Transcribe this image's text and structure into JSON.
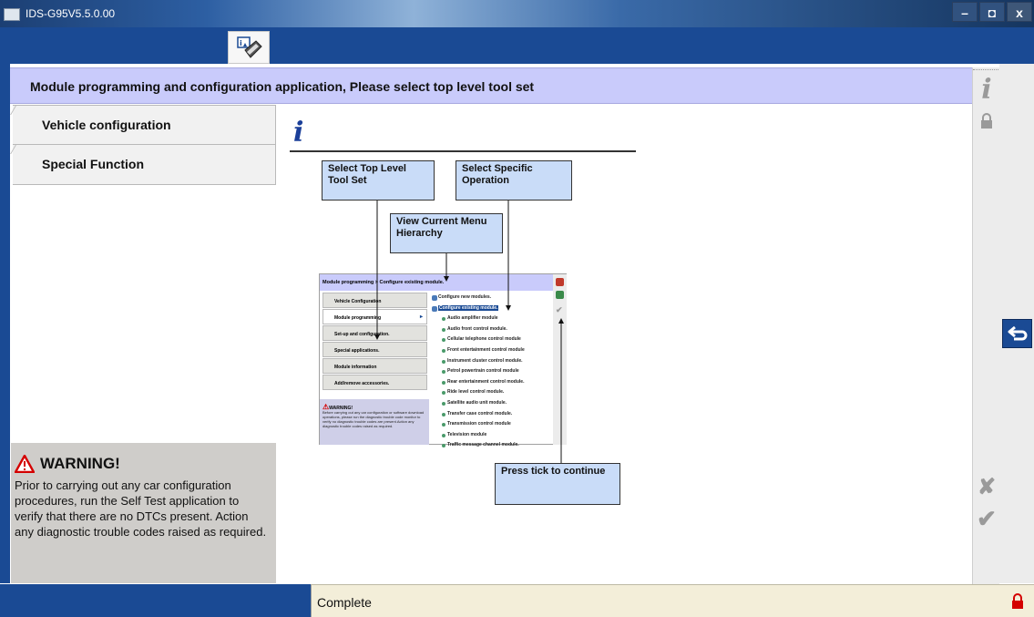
{
  "window": {
    "title": "IDS-G95V5.5.0.00",
    "controls": [
      "–",
      "◘",
      "x"
    ]
  },
  "header": {
    "title": "Module programming and configuration application, Please select top level tool set"
  },
  "nav": {
    "items": [
      {
        "label": "Vehicle configuration"
      },
      {
        "label": "Special Function"
      }
    ]
  },
  "warning": {
    "title": "WARNING!",
    "body": "Prior to carrying out any car configuration procedures, run the Self Test application to verify that there are no DTCs present. Action any diagnostic trouble codes raised as required."
  },
  "main": {
    "info_glyph": "i",
    "callouts": {
      "top_level": "Select Top Level Tool Set",
      "specific": "Select Specific Operation",
      "hierarchy": "View Current Menu Hierarchy",
      "tick": "Press tick to continue"
    },
    "embedded": {
      "breadcrumb": "Module programming > Configure existing module.",
      "nav": [
        "Vehicle Configuration",
        "Module programming",
        "Set-up and configuration.",
        "Special applications.",
        "Module information",
        "Add/remove accessories."
      ],
      "warning_title": "WARNING!",
      "warning_body": "Before carrying out any car configuration or software download operations, please run the diagnostic trouble code monitor to verify no diagnostic trouble codes are present.Action any diagnostic trouble codes raised as required.",
      "list_top": [
        "Configure new modules.",
        "Configure existing module."
      ],
      "list": [
        "Audio amplifier module",
        "Audio front control module.",
        "Cellular telephone control module",
        "Front entertainment control module",
        "Instrument cluster control module.",
        "Petrol powertrain control module",
        "Rear entertainment control module.",
        "Ride level control module.",
        "Satellite audio unit module.",
        "Transfer case control module.",
        "Transmission control module",
        "Television module",
        "Traffic message channel module."
      ]
    }
  },
  "right_toolbar": {
    "info_glyph": "i",
    "cancel_glyph": "✘",
    "confirm_glyph": "✔"
  },
  "status": {
    "text": "Complete"
  },
  "colors": {
    "toolbar_blue": "#1a4a94",
    "header_lavender": "#c9cbfb",
    "callout_blue": "#c9dcf8",
    "status_cream": "#f3eed9",
    "lock_red": "#d40000"
  }
}
